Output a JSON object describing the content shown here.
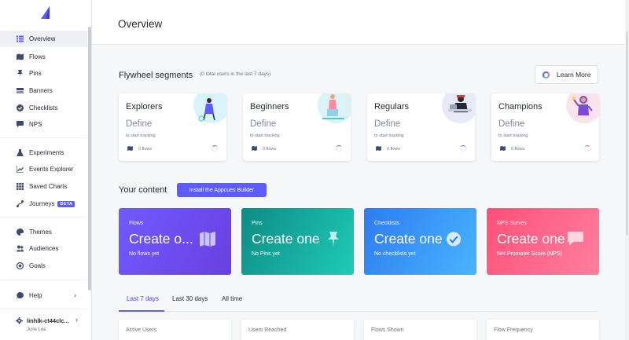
{
  "sidebar": {
    "items": [
      {
        "label": "Overview",
        "icon": "list-icon"
      },
      {
        "label": "Flows",
        "icon": "map-icon"
      },
      {
        "label": "Pins",
        "icon": "pin-icon"
      },
      {
        "label": "Banners",
        "icon": "banner-icon"
      },
      {
        "label": "Checklists",
        "icon": "check-circle-icon"
      },
      {
        "label": "NPS",
        "icon": "chat-icon"
      },
      {
        "label": "Experiments",
        "icon": "flask-icon"
      },
      {
        "label": "Events Explorer",
        "icon": "chart-icon"
      },
      {
        "label": "Saved Charts",
        "icon": "grid-icon"
      },
      {
        "label": "Journeys",
        "icon": "journey-icon",
        "badge": "BETA"
      },
      {
        "label": "Themes",
        "icon": "palette-icon"
      },
      {
        "label": "Audiences",
        "icon": "users-icon"
      },
      {
        "label": "Goals",
        "icon": "target-icon"
      },
      {
        "label": "Help",
        "icon": "help-chat-icon"
      }
    ],
    "account": {
      "name": "linhlk-ct44clc...",
      "user": "June Lee"
    }
  },
  "header": {
    "title": "Overview"
  },
  "segments": {
    "title": "Flywheel segments",
    "subtitle": "(0 total users in the last 7 days)",
    "learn_more": "Learn More",
    "cards": [
      {
        "name": "Explorers",
        "define": "Define",
        "hint": "to start tracking",
        "flows": "0 flows"
      },
      {
        "name": "Beginners",
        "define": "Define",
        "hint": "to start tracking",
        "flows": "0 flows"
      },
      {
        "name": "Regulars",
        "define": "Define",
        "hint": "to start tracking",
        "flows": "0 flows"
      },
      {
        "name": "Champions",
        "define": "Define",
        "hint": "to start tracking",
        "flows": "0 flows"
      }
    ]
  },
  "content": {
    "title": "Your content",
    "install_button": "Install the Appcues Builder",
    "cards": [
      {
        "label": "Flows",
        "big": "Create o...",
        "sub": "No flows yet"
      },
      {
        "label": "Pins",
        "big": "Create one",
        "sub": "No Pins yet"
      },
      {
        "label": "Checklists",
        "big": "Create one",
        "sub": "No checklists yet"
      },
      {
        "label": "NPS Survey",
        "big": "Create one",
        "sub": "Net Promoter Score (NPS)"
      }
    ]
  },
  "tabs": [
    {
      "label": "Last 7 days"
    },
    {
      "label": "Last 30 days"
    },
    {
      "label": "All time"
    }
  ],
  "stats": [
    {
      "label": "Active Users"
    },
    {
      "label": "Users Reached"
    },
    {
      "label": "Flows Shown"
    },
    {
      "label": "Flow Frequency"
    }
  ],
  "colors": {
    "accent": "#5c5cff",
    "flows": "#6f5bff",
    "pins": "#14a89e",
    "checklists": "#3a8ff5",
    "nps": "#ff5f85"
  }
}
